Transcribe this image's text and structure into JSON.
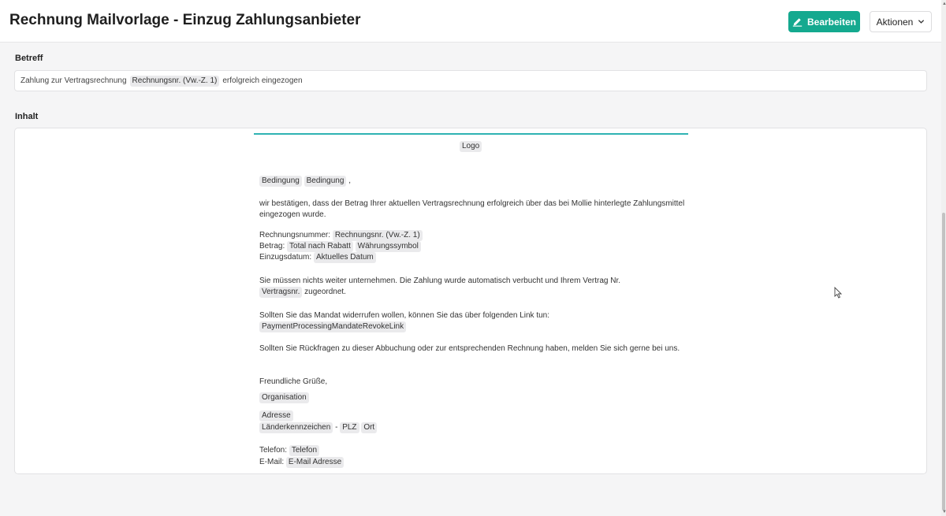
{
  "header": {
    "title": "Rechnung Mailvorlage - Einzug Zahlungsanbieter",
    "edit_label": "Bearbeiten",
    "actions_label": "Aktionen"
  },
  "subject": {
    "label": "Betreff",
    "text_before": "Zahlung zur Vertragsrechnung",
    "tag": "Rechnungsnr. (Vw.-Z. 1)",
    "text_after": "erfolgreich eingezogen"
  },
  "content": {
    "label": "Inhalt",
    "logo_tag": "Logo",
    "salutation_tag_1": "Bedingung",
    "salutation_tag_2": "Bedingung",
    "salutation_comma": ",",
    "intro": "wir bestätigen, dass der Betrag Ihrer aktuellen Vertragsrechnung erfolgreich über das bei Mollie hinterlegte Zahlungsmittel eingezogen wurde.",
    "invoice_no_label": "Rechnungsnummer:",
    "invoice_no_tag": "Rechnungsnr. (Vw.-Z. 1)",
    "amount_label": "Betrag:",
    "amount_tag": "Total nach Rabatt",
    "currency_tag": "Währungssymbol",
    "date_label": "Einzugsdatum:",
    "date_tag": "Aktuelles Datum",
    "para_booked": "Sie müssen nichts weiter unternehmen. Die Zahlung wurde automatisch verbucht und Ihrem Vertrag Nr.",
    "contract_tag": "Vertragsnr.",
    "assigned": "zugeordnet.",
    "para_revoke": "Sollten Sie das Mandat widerrufen wollen, können Sie das über folgenden Link tun:",
    "revoke_tag": "PaymentProcessingMandateRevokeLink",
    "para_questions": "Sollten Sie Rückfragen zu dieser Abbuchung oder zur entsprechenden Rechnung haben, melden Sie sich gerne bei uns.",
    "closing": "Freundliche Grüße,",
    "org_tag": "Organisation",
    "address_tag": "Adresse",
    "country_tag": "Länderkennzeichen",
    "dash": "-",
    "zip_tag": "PLZ",
    "city_tag": "Ort",
    "phone_label": "Telefon:",
    "phone_tag": "Telefon",
    "email_label": "E-Mail:",
    "email_tag": "E-Mail Adresse"
  },
  "colors": {
    "accent": "#14a98f",
    "divider": "#2fb3b3"
  }
}
